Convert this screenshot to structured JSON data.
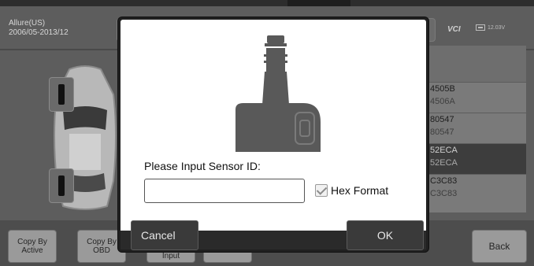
{
  "vehicle": {
    "model": "Allure(US)",
    "years": "2006/05-2013/12"
  },
  "status_bar": {
    "vci_label": "VCI",
    "battery_voltage": "12.03V"
  },
  "sensor_list": {
    "rows": [
      {
        "id": "4505B",
        "sub": "4506A",
        "selected": false
      },
      {
        "id": "80547",
        "sub": "80547",
        "selected": false
      },
      {
        "id": "52ECA",
        "sub": "52ECA",
        "selected": true
      },
      {
        "id": "C3C83",
        "sub": "C3C83",
        "selected": false
      }
    ]
  },
  "bottom_buttons": {
    "copy_by_active": "Copy By Active",
    "copy_by_obd": "Copy By OBD",
    "manual_input": "Input",
    "back": "Back"
  },
  "dialog": {
    "prompt": "Please Input Sensor ID:",
    "input_value": "",
    "input_placeholder": "",
    "hex_format_label": "Hex Format",
    "hex_format_checked": true,
    "cancel_label": "Cancel",
    "ok_label": "OK"
  },
  "colors": {
    "dialog_bg": "#202020",
    "sensor_icon": "#595959",
    "selected_row": "#3d3d3d"
  }
}
